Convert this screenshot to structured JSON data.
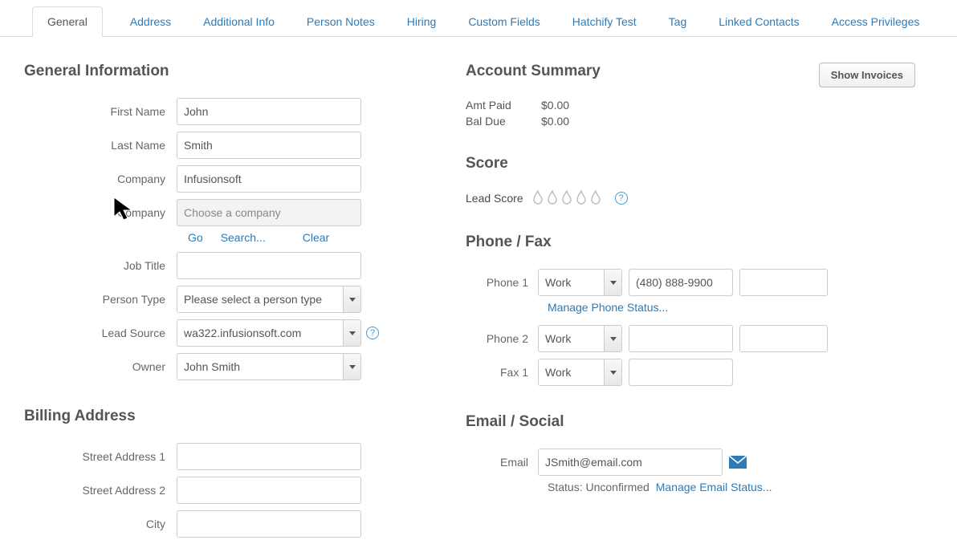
{
  "tabs": {
    "items": [
      {
        "label": "General",
        "active": true
      },
      {
        "label": "Address"
      },
      {
        "label": "Additional Info"
      },
      {
        "label": "Person Notes"
      },
      {
        "label": "Hiring"
      },
      {
        "label": "Custom Fields"
      },
      {
        "label": "Hatchify Test"
      },
      {
        "label": "Tag"
      },
      {
        "label": "Linked Contacts"
      },
      {
        "label": "Access Privileges"
      }
    ]
  },
  "general": {
    "heading": "General Information",
    "first_name_label": "First Name",
    "first_name_value": "John",
    "last_name_label": "Last Name",
    "last_name_value": "Smith",
    "company_label": "Company",
    "company_value": "Infusionsoft",
    "company_picker_label": "Company",
    "company_picker_placeholder": "Choose a company",
    "go_link": "Go",
    "search_link": "Search...",
    "clear_link": "Clear",
    "job_title_label": "Job Title",
    "job_title_value": "",
    "person_type_label": "Person Type",
    "person_type_value": "Please select a person type",
    "lead_source_label": "Lead Source",
    "lead_source_value": "wa322.infusionsoft.com",
    "owner_label": "Owner",
    "owner_value": "John Smith"
  },
  "billing": {
    "heading": "Billing Address",
    "street1_label": "Street Address 1",
    "street1_value": "",
    "street2_label": "Street Address 2",
    "street2_value": "",
    "city_label": "City"
  },
  "account": {
    "heading": "Account Summary",
    "show_invoices_label": "Show Invoices",
    "amt_paid_label": "Amt Paid",
    "amt_paid_value": "$0.00",
    "bal_due_label": "Bal Due",
    "bal_due_value": "$0.00"
  },
  "score": {
    "heading": "Score",
    "lead_score_label": "Lead Score"
  },
  "phone": {
    "heading": "Phone / Fax",
    "phone1_label": "Phone 1",
    "phone1_type": "Work",
    "phone1_number": "(480) 888-9900",
    "phone1_ext": "",
    "manage_status": "Manage Phone Status...",
    "phone2_label": "Phone 2",
    "phone2_type": "Work",
    "phone2_number": "",
    "phone2_ext": "",
    "fax1_label": "Fax 1",
    "fax1_type": "Work",
    "fax1_number": ""
  },
  "email": {
    "heading": "Email / Social",
    "email_label": "Email",
    "email_value": "JSmith@email.com",
    "status_prefix": "Status: Unconfirmed",
    "manage_link": "Manage Email Status..."
  }
}
